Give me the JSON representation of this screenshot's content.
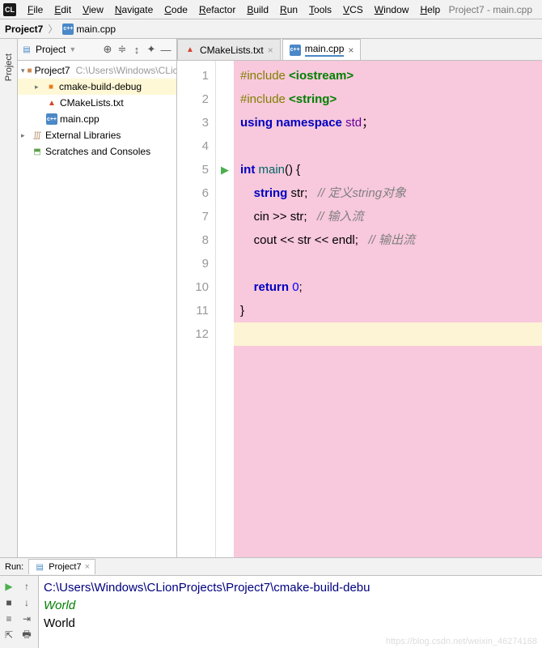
{
  "window": {
    "title": "Project7 - main.cpp"
  },
  "menu": [
    "File",
    "Edit",
    "View",
    "Navigate",
    "Code",
    "Refactor",
    "Build",
    "Run",
    "Tools",
    "VCS",
    "Window",
    "Help"
  ],
  "breadcrumb": {
    "project": "Project7",
    "file": "main.cpp"
  },
  "sidebar_label": "Project",
  "project_pane": {
    "title": "Project",
    "tree": {
      "root": {
        "name": "Project7",
        "path": "C:\\Users\\Windows\\CLic"
      },
      "children": [
        {
          "name": "cmake-build-debug",
          "folder": true
        },
        {
          "name": "CMakeLists.txt"
        },
        {
          "name": "main.cpp"
        }
      ],
      "ext_libs": "External Libraries",
      "scratches": "Scratches and Consoles"
    }
  },
  "tabs": [
    {
      "label": "CMakeLists.txt",
      "active": false
    },
    {
      "label": "main.cpp",
      "active": true
    }
  ],
  "code": {
    "lines": [
      {
        "n": 1,
        "tokens": [
          [
            "kw-pp",
            "#include "
          ],
          [
            "kw-inc",
            "<iostream>"
          ]
        ]
      },
      {
        "n": 2,
        "tokens": [
          [
            "kw-pp",
            "#include "
          ],
          [
            "kw-inc",
            "<string>"
          ]
        ]
      },
      {
        "n": 3,
        "tokens": [
          [
            "kw-blue",
            "using "
          ],
          [
            "kw-blue",
            "namespace "
          ],
          [
            "kw-purple",
            "std"
          ],
          [
            "",
            "；"
          ]
        ]
      },
      {
        "n": 4,
        "tokens": []
      },
      {
        "n": 5,
        "run": true,
        "tokens": [
          [
            "kw-blue",
            "int "
          ],
          [
            "fn",
            "main"
          ],
          [
            "",
            "() {"
          ]
        ]
      },
      {
        "n": 6,
        "tokens": [
          [
            "",
            "    "
          ],
          [
            "kw-blue",
            "string "
          ],
          [
            "",
            "str;   "
          ],
          [
            "comment",
            "// 定义string对象"
          ]
        ]
      },
      {
        "n": 7,
        "tokens": [
          [
            "",
            "    cin >> str;   "
          ],
          [
            "comment",
            "// 输入流"
          ]
        ]
      },
      {
        "n": 8,
        "tokens": [
          [
            "",
            "    cout << str << endl;   "
          ],
          [
            "comment",
            "// 输出流"
          ]
        ]
      },
      {
        "n": 9,
        "tokens": []
      },
      {
        "n": 10,
        "tokens": [
          [
            "",
            "    "
          ],
          [
            "kw-blue",
            "return "
          ],
          [
            "num",
            "0"
          ],
          [
            "",
            ";"
          ]
        ]
      },
      {
        "n": 11,
        "tokens": [
          [
            "",
            "}"
          ]
        ]
      },
      {
        "n": 12,
        "blank": true,
        "tokens": []
      }
    ]
  },
  "run_pane": {
    "label": "Run:",
    "tab": "Project7",
    "lines": [
      {
        "cls": "path",
        "text": "C:\\Users\\Windows\\CLionProjects\\Project7\\cmake-build-debu"
      },
      {
        "cls": "input",
        "text": "World"
      },
      {
        "cls": "",
        "text": "World"
      }
    ]
  },
  "watermark": "https://blog.csdn.net/weixin_46274168"
}
